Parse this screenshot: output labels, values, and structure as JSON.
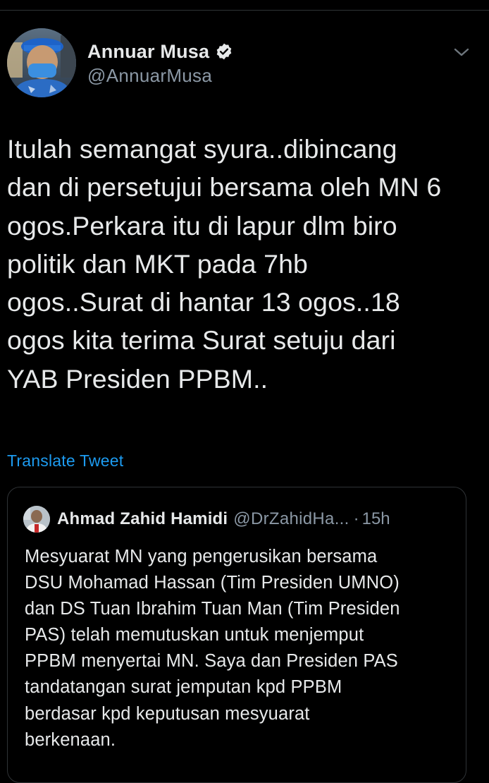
{
  "tweet": {
    "author": {
      "display_name": "Annuar Musa",
      "handle": "@AnnuarMusa",
      "verified": true
    },
    "text": "Itulah semangat syura..dibincang\ndan di persetujui bersama oleh MN 6\nogos.Perkara itu di lapur dlm biro\npolitik dan MKT pada 7hb\nogos..Surat di hantar 13 ogos..18\nogos kita terima Surat setuju dari\nYAB Presiden PPBM..",
    "translate_label": "Translate Tweet"
  },
  "quoted_tweet": {
    "author": {
      "display_name": "Ahmad Zahid Hamidi",
      "handle": "@DrZahidHa...",
      "separator": "·",
      "time": "15h"
    },
    "text": "Mesyuarat MN yang pengerusikan bersama\nDSU Mohamad Hassan (Tim Presiden UMNO)\ndan DS Tuan Ibrahim Tuan Man (Tim Presiden\nPAS) telah memutuskan untuk menjemput\nPPBM menyertai MN. Saya dan Presiden PAS\ntandatangan surat jemputan kpd PPBM\nberdasar kpd keputusan mesyuarat\nberkenaan."
  },
  "icons": {
    "verified": "verified-badge-icon",
    "more": "chevron-down-icon"
  },
  "colors": {
    "background": "#000000",
    "text_primary": "#e7e9ea",
    "text_secondary": "#8b98a5",
    "link": "#1d9bf0",
    "border": "#2f3336"
  }
}
